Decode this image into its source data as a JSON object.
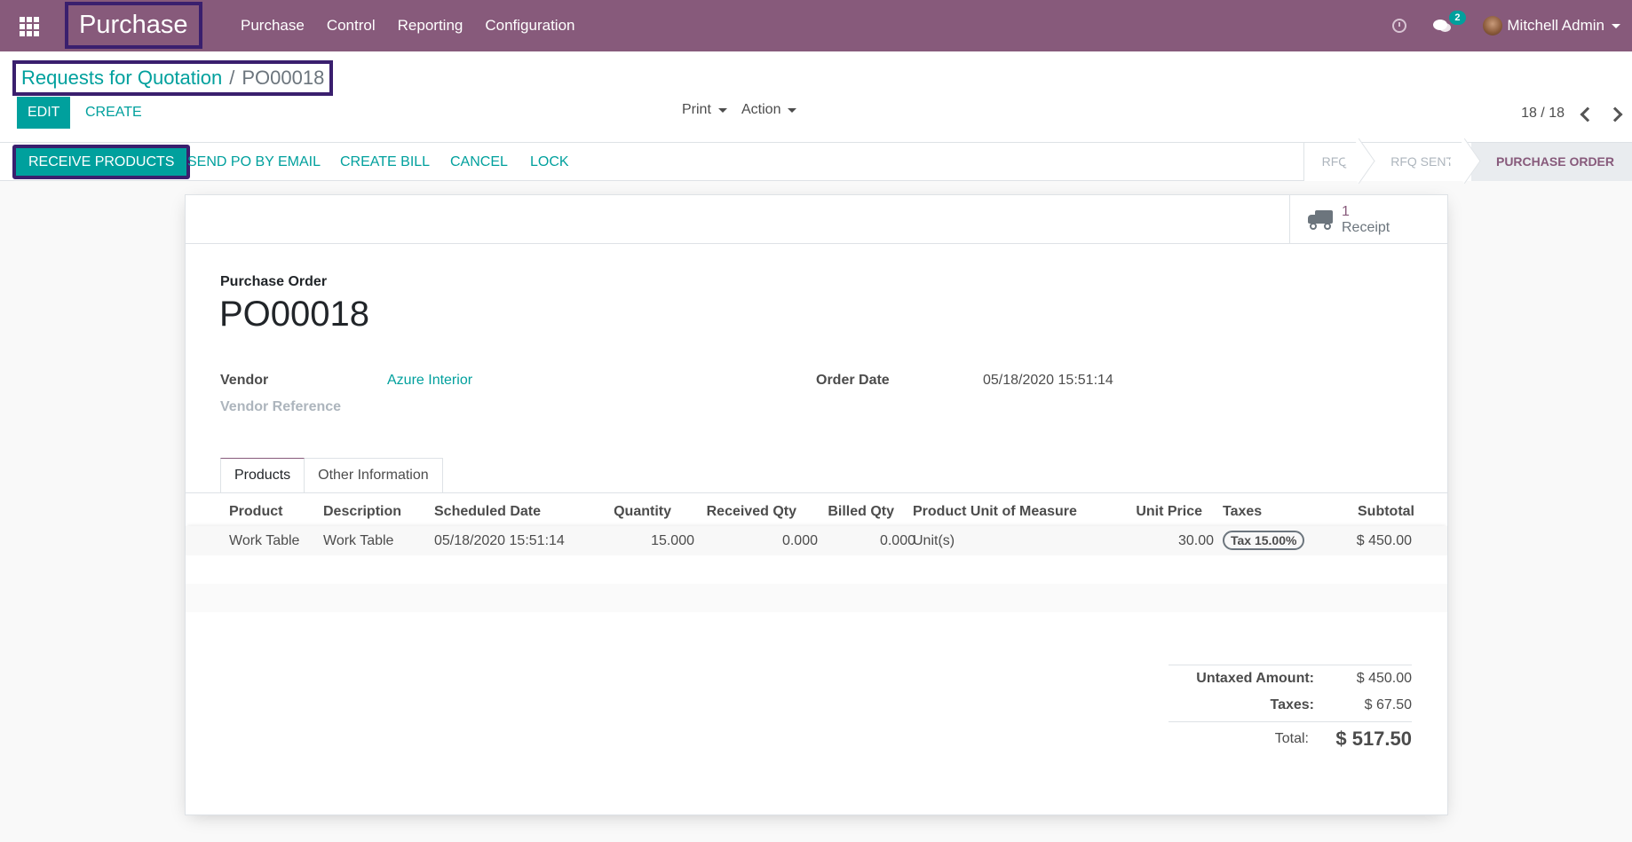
{
  "topbar": {
    "brand": "Purchase",
    "menu": [
      "Purchase",
      "Control",
      "Reporting",
      "Configuration"
    ],
    "messages_badge": "2",
    "user": "Mitchell Admin",
    "icons": {
      "apps": "apps-grid-icon",
      "activity": "clock-icon",
      "messages": "chat-icon"
    }
  },
  "control_panel": {
    "breadcrumb": {
      "parent": "Requests for Quotation",
      "separator": "/",
      "current": "PO00018"
    },
    "edit_label": "EDIT",
    "create_label": "CREATE",
    "print_label": "Print",
    "action_label": "Action",
    "pager": "18 / 18"
  },
  "statusbar": {
    "buttons": [
      "RECEIVE PRODUCTS",
      "SEND PO BY EMAIL",
      "CREATE BILL",
      "CANCEL",
      "LOCK"
    ],
    "stages": [
      "RFQ",
      "RFQ SENT",
      "PURCHASE ORDER"
    ],
    "active_stage": "PURCHASE ORDER"
  },
  "sheet": {
    "smart_button": {
      "value": "1",
      "label": "Receipt",
      "icon": "truck-icon"
    },
    "title_label": "Purchase Order",
    "title": "PO00018",
    "fields": {
      "vendor_label": "Vendor",
      "vendor_value": "Azure Interior",
      "vendor_ref_label": "Vendor Reference",
      "order_date_label": "Order Date",
      "order_date_value": "05/18/2020 15:51:14"
    },
    "tabs": [
      "Products",
      "Other Information"
    ],
    "table": {
      "columns": [
        "Product",
        "Description",
        "Scheduled Date",
        "Quantity",
        "Received Qty",
        "Billed Qty",
        "Product Unit of Measure",
        "Unit Price",
        "Taxes",
        "Subtotal"
      ],
      "rows": [
        {
          "product": "Work Table",
          "description": "Work Table",
          "scheduled_date": "05/18/2020 15:51:14",
          "quantity": "15.000",
          "received": "0.000",
          "billed": "0.000",
          "uom": "Unit(s)",
          "unit_price": "30.00",
          "taxes": "Tax 15.00%",
          "subtotal": "$ 450.00"
        }
      ]
    },
    "totals": {
      "untaxed_label": "Untaxed Amount:",
      "untaxed_value": "$ 450.00",
      "taxes_label": "Taxes:",
      "taxes_value": "$ 67.50",
      "total_label": "Total:",
      "total_value": "$ 517.50"
    }
  },
  "colors": {
    "brand": "#875a7b",
    "accent": "#00a09d",
    "highlight_border": "#3a1f6e"
  }
}
